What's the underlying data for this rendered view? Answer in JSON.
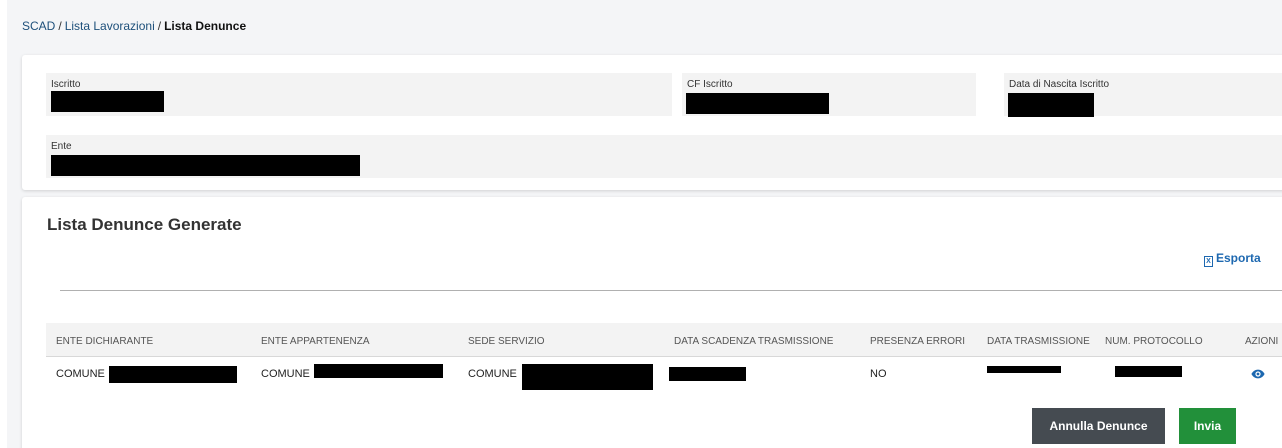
{
  "breadcrumb": {
    "root": "SCAD",
    "separator": "/",
    "item1": "Lista Lavorazioni",
    "current": "Lista Denunce"
  },
  "info": {
    "iscritto_label": "Iscritto",
    "cf_label": "CF Iscritto",
    "nascita_label": "Data di Nascita Iscritto",
    "ente_label": "Ente"
  },
  "list": {
    "title": "Lista Denunce Generate",
    "export_label": "Esporta",
    "columns": [
      "ENTE DICHIARANTE",
      "ENTE APPARTENENZA",
      "SEDE SERVIZIO",
      "DATA SCADENZA TRASMISSIONE",
      "PRESENZA ERRORI",
      "DATA TRASMISSIONE",
      "NUM. PROTOCOLLO",
      "AZIONI"
    ],
    "rows": [
      {
        "ente_dichiarante": "COMUNE",
        "ente_appartenenza": "COMUNE",
        "sede_servizio": "COMUNE",
        "presenza_errori": "NO"
      }
    ]
  },
  "actions": {
    "cancel_label": "Annulla Denunce",
    "send_label": "Invia"
  },
  "colors": {
    "link": "#1d68b0",
    "cancel_button": "#454b51",
    "send_button": "#22903a"
  },
  "icons": {
    "export": "excel-file-icon",
    "view": "eye-icon"
  }
}
